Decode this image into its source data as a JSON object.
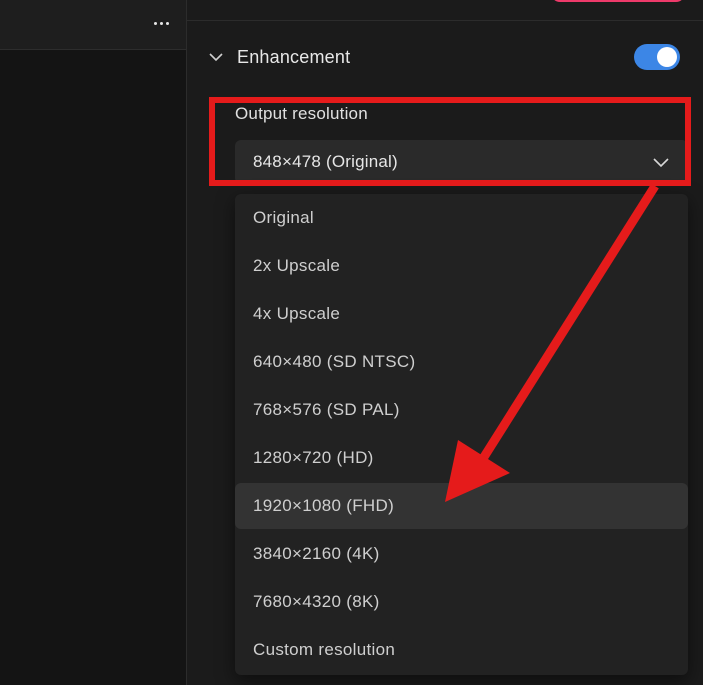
{
  "left_panel": {
    "more_icon": "more-horizontal-icon"
  },
  "right_panel": {
    "section": {
      "title": "Enhancement",
      "chevron_icon": "chevron-down-icon",
      "toggle_on": true,
      "toggle_color": "#3c86e6"
    },
    "output_resolution": {
      "label": "Output resolution",
      "selected_value": "848×478 (Original)",
      "chevron_icon": "chevron-down-icon",
      "options": [
        "Original",
        "2x Upscale",
        "4x Upscale",
        "640×480 (SD NTSC)",
        "768×576 (SD PAL)",
        "1280×720 (HD)",
        "1920×1080 (FHD)",
        "3840×2160 (4K)",
        "7680×4320 (8K)",
        "Custom resolution"
      ],
      "highlighted_option": "1920×1080 (FHD)"
    }
  },
  "annotation": {
    "color": "#e51b1b"
  }
}
